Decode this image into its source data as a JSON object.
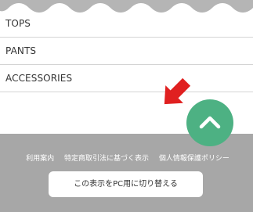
{
  "menu": {
    "items": [
      {
        "label": "TOPS"
      },
      {
        "label": "PANTS"
      },
      {
        "label": "ACCESSORIES"
      }
    ]
  },
  "footer": {
    "links": [
      {
        "label": "利用案内"
      },
      {
        "label": "特定商取引法に基づく表示"
      },
      {
        "label": "個人情報保護ポリシー"
      }
    ],
    "pc_view_button": "この表示をPC用に切り替える"
  },
  "scroll_top": {
    "icon": "chevron-up-icon",
    "color": "#4db183"
  },
  "annotation": {
    "icon": "red-arrow-icon",
    "color": "#e02020"
  },
  "colors": {
    "footer_bg": "#a7a7a7",
    "divider": "#d4d4d4",
    "wave": "#b5b5b5"
  }
}
